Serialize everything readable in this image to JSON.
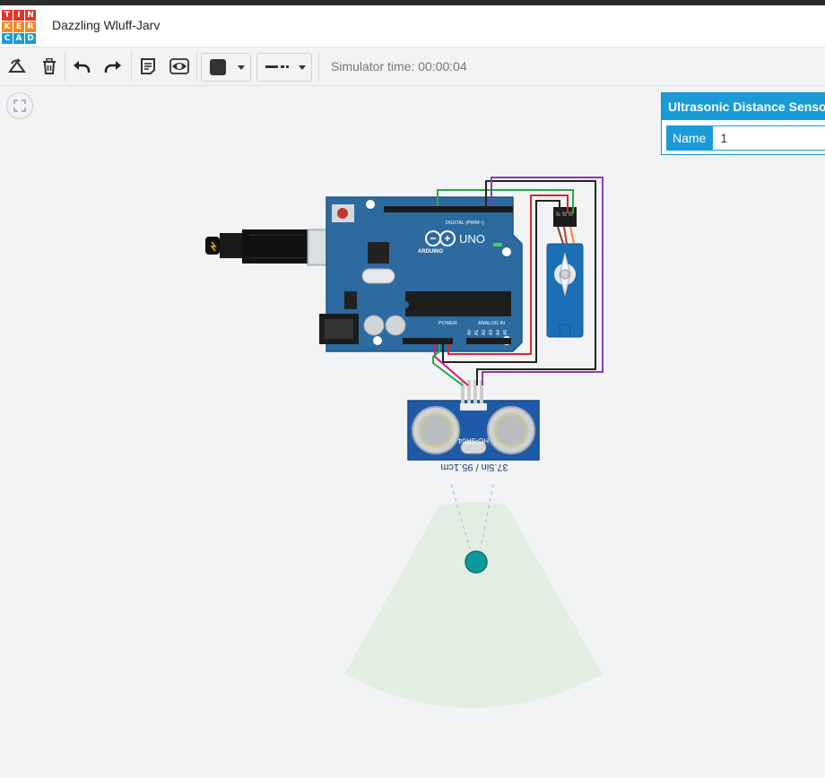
{
  "app": {
    "logo_letters": [
      "T",
      "I",
      "N",
      "K",
      "E",
      "R",
      "C",
      "A",
      "D"
    ],
    "logo_colors": [
      "#e2342b",
      "#e2342b",
      "#e2342b",
      "#f08b23",
      "#f08b23",
      "#f08b23",
      "#1a9bd7",
      "#1a9bd7",
      "#1a9bd7"
    ],
    "title": "Dazzling Wluff-Jarv"
  },
  "toolbar": {
    "rotate_icon": "rotate-icon",
    "delete_icon": "trash-icon",
    "undo_icon": "undo-icon",
    "redo_icon": "redo-icon",
    "notes_icon": "notes-icon",
    "visibility_icon": "eye-icon",
    "fill_color": "#333333",
    "simulator_time": "Simulator time: 00:00:04"
  },
  "inspector": {
    "component_name": "Ultrasonic Distance Sensor",
    "name_label": "Name",
    "name_value": "1"
  },
  "circuit": {
    "board_brand": "ARDUINO",
    "board_model": "UNO",
    "digital_label": "DIGITAL (PWM~)",
    "power_label": "POWER",
    "analog_label": "ANALOG IN",
    "sensor_model": "HC-SR04",
    "sensor_readout": "37.5in / 95.1cm",
    "pin_labels_analog": [
      "A0",
      "A1",
      "A2",
      "A3",
      "A4",
      "A5"
    ],
    "accent": "#1a9bd7",
    "board_color": "#2c6aa0",
    "target_color": "#0e9a9a",
    "sensor_range_color": "#e3eee3"
  }
}
